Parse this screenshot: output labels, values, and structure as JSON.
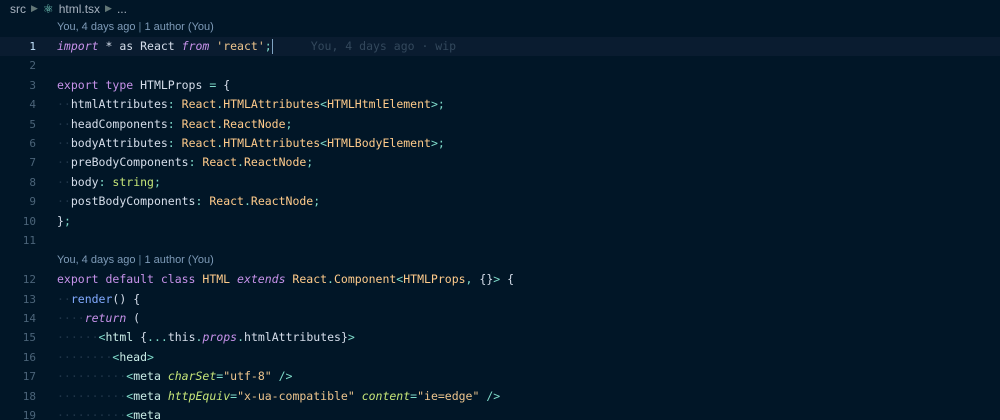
{
  "breadcrumb": {
    "folder": "src",
    "file": "html.tsx",
    "ellipsis": "..."
  },
  "codelens": [
    {
      "author_time": "You, 4 days ago",
      "separator": "|",
      "authors": "1 author (You)"
    },
    {
      "author_time": "You, 4 days ago",
      "separator": "|",
      "authors": "1 author (You)"
    }
  ],
  "inline_blame": "You, 4 days ago · wip",
  "theme_colors": {
    "background": "#011627",
    "keyword": "#c792ea",
    "type": "#ffcb8b",
    "string": "#ecc48d",
    "function": "#82aaff",
    "jsx_attribute": "#c5e478"
  },
  "lines": [
    {
      "n": "1",
      "t": [
        [
          "kwi",
          "import"
        ],
        [
          "plain",
          " * "
        ],
        [
          "plain",
          "as "
        ],
        [
          "plain",
          "React "
        ],
        [
          "kwi",
          "from "
        ],
        [
          "str",
          "'react'"
        ],
        [
          "punc",
          ";"
        ]
      ]
    },
    {
      "n": "2",
      "t": []
    },
    {
      "n": "3",
      "t": [
        [
          "kw",
          "export "
        ],
        [
          "kw",
          "type "
        ],
        [
          "plain",
          "HTMLProps "
        ],
        [
          "punc",
          "= "
        ],
        [
          "br",
          "{"
        ]
      ]
    },
    {
      "n": "4",
      "t": [
        [
          "ws",
          "··"
        ],
        [
          "prop",
          "htmlAttributes"
        ],
        [
          "punc",
          ": "
        ],
        [
          "ty",
          "React"
        ],
        [
          "punc",
          "."
        ],
        [
          "ty",
          "HTMLAttributes"
        ],
        [
          "punc",
          "<"
        ],
        [
          "ty",
          "HTMLHtmlElement"
        ],
        [
          "punc",
          ">"
        ],
        [
          "punc",
          ";"
        ]
      ]
    },
    {
      "n": "5",
      "t": [
        [
          "ws",
          "··"
        ],
        [
          "prop",
          "headComponents"
        ],
        [
          "punc",
          ": "
        ],
        [
          "ty",
          "React"
        ],
        [
          "punc",
          "."
        ],
        [
          "ty",
          "ReactNode"
        ],
        [
          "punc",
          ";"
        ]
      ]
    },
    {
      "n": "6",
      "t": [
        [
          "ws",
          "··"
        ],
        [
          "prop",
          "bodyAttributes"
        ],
        [
          "punc",
          ": "
        ],
        [
          "ty",
          "React"
        ],
        [
          "punc",
          "."
        ],
        [
          "ty",
          "HTMLAttributes"
        ],
        [
          "punc",
          "<"
        ],
        [
          "ty",
          "HTMLBodyElement"
        ],
        [
          "punc",
          ">"
        ],
        [
          "punc",
          ";"
        ]
      ]
    },
    {
      "n": "7",
      "t": [
        [
          "ws",
          "··"
        ],
        [
          "prop",
          "preBodyComponents"
        ],
        [
          "punc",
          ": "
        ],
        [
          "ty",
          "React"
        ],
        [
          "punc",
          "."
        ],
        [
          "ty",
          "ReactNode"
        ],
        [
          "punc",
          ";"
        ]
      ]
    },
    {
      "n": "8",
      "t": [
        [
          "ws",
          "··"
        ],
        [
          "prop",
          "body"
        ],
        [
          "punc",
          ": "
        ],
        [
          "prim",
          "string"
        ],
        [
          "punc",
          ";"
        ]
      ]
    },
    {
      "n": "9",
      "t": [
        [
          "ws",
          "··"
        ],
        [
          "prop",
          "postBodyComponents"
        ],
        [
          "punc",
          ": "
        ],
        [
          "ty",
          "React"
        ],
        [
          "punc",
          "."
        ],
        [
          "ty",
          "ReactNode"
        ],
        [
          "punc",
          ";"
        ]
      ]
    },
    {
      "n": "10",
      "t": [
        [
          "br",
          "}"
        ],
        [
          "punc",
          ";"
        ]
      ]
    },
    {
      "n": "11",
      "t": []
    },
    {
      "n": "12",
      "t": [
        [
          "kw",
          "export "
        ],
        [
          "kw",
          "default "
        ],
        [
          "kw",
          "class "
        ],
        [
          "cl",
          "HTML "
        ],
        [
          "kwi",
          "extends "
        ],
        [
          "ty",
          "React"
        ],
        [
          "punc",
          "."
        ],
        [
          "ty",
          "Component"
        ],
        [
          "punc",
          "<"
        ],
        [
          "ty",
          "HTMLProps"
        ],
        [
          "punc",
          ", "
        ],
        [
          "br",
          "{}"
        ],
        [
          "punc",
          ">"
        ],
        [
          "plain",
          " "
        ],
        [
          "br",
          "{"
        ]
      ]
    },
    {
      "n": "13",
      "t": [
        [
          "ws",
          "··"
        ],
        [
          "fn",
          "render"
        ],
        [
          "br",
          "() "
        ],
        [
          "br",
          "{"
        ]
      ]
    },
    {
      "n": "14",
      "t": [
        [
          "ws",
          "····"
        ],
        [
          "kwi",
          "return "
        ],
        [
          "br",
          "("
        ]
      ]
    },
    {
      "n": "15",
      "t": [
        [
          "ws",
          "······"
        ],
        [
          "punc",
          "<"
        ],
        [
          "tag",
          "html "
        ],
        [
          "br",
          "{"
        ],
        [
          "punc",
          "..."
        ],
        [
          "this",
          "this"
        ],
        [
          "punc",
          "."
        ],
        [
          "kwi",
          "props"
        ],
        [
          "punc",
          "."
        ],
        [
          "plain",
          "htmlAttributes"
        ],
        [
          "br",
          "}"
        ],
        [
          "punc",
          ">"
        ]
      ]
    },
    {
      "n": "16",
      "t": [
        [
          "ws",
          "········"
        ],
        [
          "punc",
          "<"
        ],
        [
          "tag",
          "head"
        ],
        [
          "punc",
          ">"
        ]
      ]
    },
    {
      "n": "17",
      "t": [
        [
          "ws",
          "··········"
        ],
        [
          "punc",
          "<"
        ],
        [
          "tag",
          "meta "
        ],
        [
          "attr",
          "charSet"
        ],
        [
          "punc",
          "="
        ],
        [
          "str",
          "\"utf-8\" "
        ],
        [
          "punc",
          "/>"
        ]
      ]
    },
    {
      "n": "18",
      "t": [
        [
          "ws",
          "··········"
        ],
        [
          "punc",
          "<"
        ],
        [
          "tag",
          "meta "
        ],
        [
          "attr",
          "httpEquiv"
        ],
        [
          "punc",
          "="
        ],
        [
          "str",
          "\"x-ua-compatible\" "
        ],
        [
          "attr",
          "content"
        ],
        [
          "punc",
          "="
        ],
        [
          "str",
          "\"ie=edge\" "
        ],
        [
          "punc",
          "/>"
        ]
      ]
    },
    {
      "n": "19",
      "t": [
        [
          "ws",
          "··········"
        ],
        [
          "punc",
          "<"
        ],
        [
          "tag",
          "meta"
        ]
      ]
    }
  ]
}
